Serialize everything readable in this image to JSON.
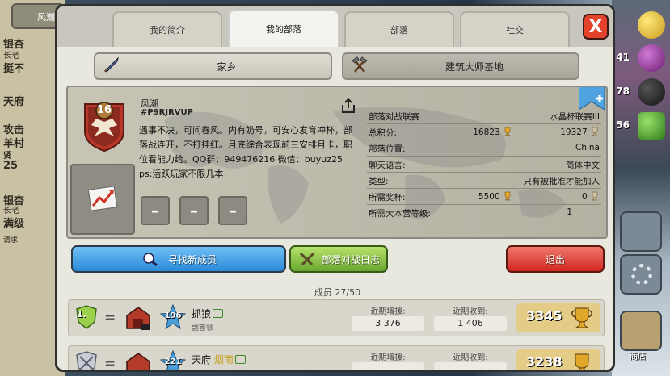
{
  "background": {
    "left_top_name": "风潮",
    "left_rows": [
      "银杏",
      "长老",
      "挺不",
      "天府",
      "攻击",
      "羊村",
      "贤",
      "25",
      "银杏",
      "长老",
      "满级",
      "请求:"
    ],
    "right_nums": [
      "41",
      "78",
      "56"
    ],
    "shop_label": "商店"
  },
  "tabs": [
    {
      "label": "我的简介",
      "active": false
    },
    {
      "label": "我的部落",
      "active": true
    },
    {
      "label": "部落",
      "active": false
    },
    {
      "label": "社交",
      "active": false
    }
  ],
  "close_label": "X",
  "sub_buttons": {
    "home": "家乡",
    "builder": "建筑大师基地"
  },
  "clan": {
    "level": "16",
    "name": "风潮",
    "tag": "#P9RJRVUP",
    "description": "遇事不决，可问春风。内有奶号，可安心发育冲杯，部落战连开，不打挂红。月底综合表现前三安排月卡，职位看能力给。QQ群：949476216 微信：buyuz25  ps:活跃玩家不限几本",
    "dash_1": "–",
    "dash_2": "–",
    "dash_3": "–"
  },
  "stats": {
    "war_league_label": "部落对战联赛",
    "war_league_value": "水晶杯联赛III",
    "points_label": "总积分:",
    "points_main": "16823",
    "points_builder": "19327",
    "location_label": "部落位置:",
    "location_value": "China",
    "language_label": "聊天语言:",
    "language_value": "简体中文",
    "type_label": "类型:",
    "type_value": "只有被批准才能加入",
    "req_trophies_label": "所需奖杯:",
    "req_trophies_main": "5500",
    "req_trophies_builder": "0",
    "req_bh_label": "所需大本营等级:",
    "req_bh_value": "1"
  },
  "actions": {
    "find_members": "寻找新成员",
    "war_log": "部落对战日志",
    "leave": "退出"
  },
  "members_count": "成员 27/50",
  "members": [
    {
      "rank": "1.",
      "xp": "196",
      "name": "抓狼",
      "role": "副首领",
      "donated_label": "近期增援:",
      "donated": "3 376",
      "received_label": "近期收到:",
      "received": "1 406",
      "trophies": "3345"
    },
    {
      "rank": "",
      "xp": "221",
      "name": "天府",
      "name_suffix": "烟雨",
      "role": "",
      "donated_label": "近期增援:",
      "donated": "",
      "received_label": "近期收到:",
      "received": "",
      "trophies": "3238"
    }
  ],
  "colors": {
    "find_btn": "#3a9ee6",
    "war_btn": "#8ec63f",
    "leave_btn": "#e8433a",
    "close_btn": "#e3432d"
  }
}
